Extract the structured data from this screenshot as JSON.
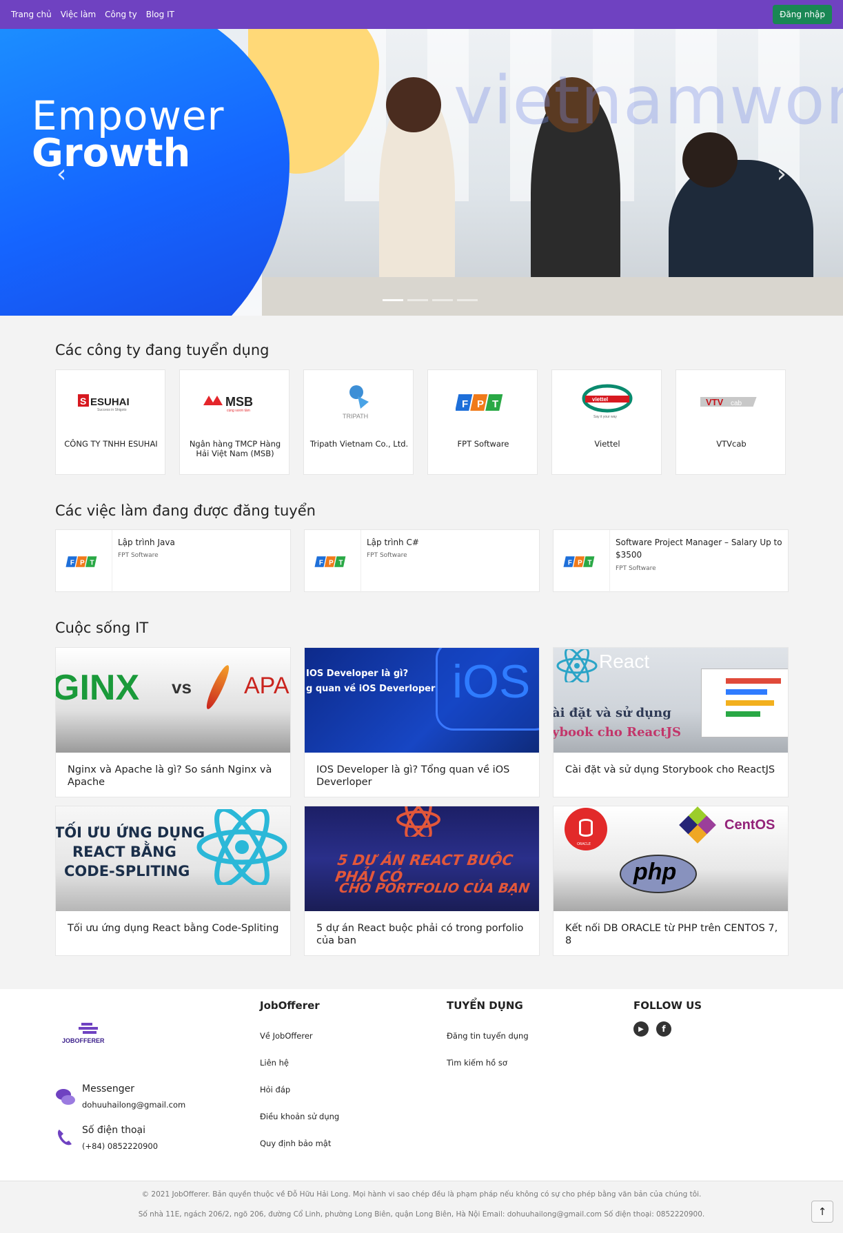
{
  "navbar": {
    "links": [
      "Trang chủ",
      "Việc làm",
      "Công ty",
      "Blog IT"
    ],
    "login_label": "Đăng nhập",
    "brand_color": "#6f42c1",
    "login_color": "#198754"
  },
  "hero": {
    "title_line1": "Empower",
    "title_line2": "Growth",
    "watermark": "vietnamworks",
    "slide_count": 4,
    "active_slide": 1
  },
  "companies": {
    "title": "Các công ty đang tuyển dụng",
    "items": [
      {
        "name": "CÔNG TY TNHH ESUHAI",
        "logo_text": "ESUHAI",
        "logo_sub": "Success in Shigoto"
      },
      {
        "name": "Ngân hàng TMCP Hàng Hải Việt Nam (MSB)",
        "logo_text": "MSB",
        "logo_sub": "cùng vươn tầm"
      },
      {
        "name": "Tripath Vietnam Co., Ltd.",
        "logo_text": "TRIPATH",
        "logo_sub": ""
      },
      {
        "name": "FPT Software",
        "logo_text": "FPT",
        "logo_sub": ""
      },
      {
        "name": "Viettel",
        "logo_text": "viettel",
        "logo_sub": "Say it your way"
      },
      {
        "name": "VTVcab",
        "logo_text": "VTVcab",
        "logo_sub": ""
      }
    ]
  },
  "jobs": {
    "title": "Các việc làm đang được đăng tuyển",
    "items": [
      {
        "title": "Lập trình Java",
        "company": "FPT Software"
      },
      {
        "title": "Lập trình C#",
        "company": "FPT Software"
      },
      {
        "title": "Software Project Manager – Salary Up to $3500",
        "company": "FPT Software"
      }
    ]
  },
  "blog": {
    "title": "Cuộc sống IT",
    "items": [
      {
        "title": "Nginx và Apache là gì? So sánh Nginx và Apache",
        "img_text_a": "GINX",
        "img_text_b": "vs",
        "img_text_c": "APA"
      },
      {
        "title": "IOS Developer là gì? Tổng quan về iOS Deverloper",
        "img_text_a": "IOS Developer là gì?",
        "img_text_b": "g quan về iOS Deverloper",
        "img_text_c": "iOS"
      },
      {
        "title": "Cài đặt và sử dụng Storybook cho ReactJS",
        "img_text_a": "React",
        "img_text_b": "ài đặt và sử dụng",
        "img_text_c": "ybook cho ReactJS"
      },
      {
        "title": "Tối ưu ứng dụng React bằng Code-Spliting",
        "img_text_a": "TỐI ƯU ỨNG DỤNG",
        "img_text_b": "REACT BẰNG",
        "img_text_c": "CODE-SPLITING"
      },
      {
        "title": "5 dự án React buộc phải có trong porfolio của ban",
        "img_text_a": "5 DỰ ÁN REACT BUỘC PHẢI CÓ",
        "img_text_b": "CHO PORTFOLIO CỦA BẠN",
        "img_text_c": ""
      },
      {
        "title": "Kết nối DB ORACLE từ PHP trên CENTOS 7, 8",
        "img_text_a": "CentOS",
        "img_text_b": "php",
        "img_text_c": "ORACLE"
      }
    ]
  },
  "footer": {
    "logo_text": "JOBOFFERER",
    "messenger_title": "Messenger",
    "messenger_value": "dohuuhailong@gmail.com",
    "phone_title": "Số điện thoại",
    "phone_value": "(+84) 0852220900",
    "col1_title": "JobOfferer",
    "col1_links": [
      "Về JobOfferer",
      "Liên hệ",
      "Hỏi đáp",
      "Điều khoản sử dụng",
      "Quy định bảo mật"
    ],
    "col2_title": "TUYỂN DỤNG",
    "col2_links": [
      "Đăng tin tuyển dụng",
      "Tìm kiếm hồ sơ"
    ],
    "col3_title": "FOLLOW US",
    "social": [
      "youtube-icon",
      "facebook-icon"
    ]
  },
  "copyright": {
    "line1": "© 2021 JobOfferer. Bản quyền thuộc về Đỗ Hữu Hải Long. Mọi hành vi sao chép đều là phạm pháp nếu không có sự cho phép bằng văn bản của chúng tôi.",
    "line2": "Số nhà 11E, ngách 206/2, ngõ 206, đường Cổ Linh, phường Long Biên, quận Long Biên, Hà Nội Email: dohuuhailong@gmail.com Số điện thoại: 0852220900."
  }
}
